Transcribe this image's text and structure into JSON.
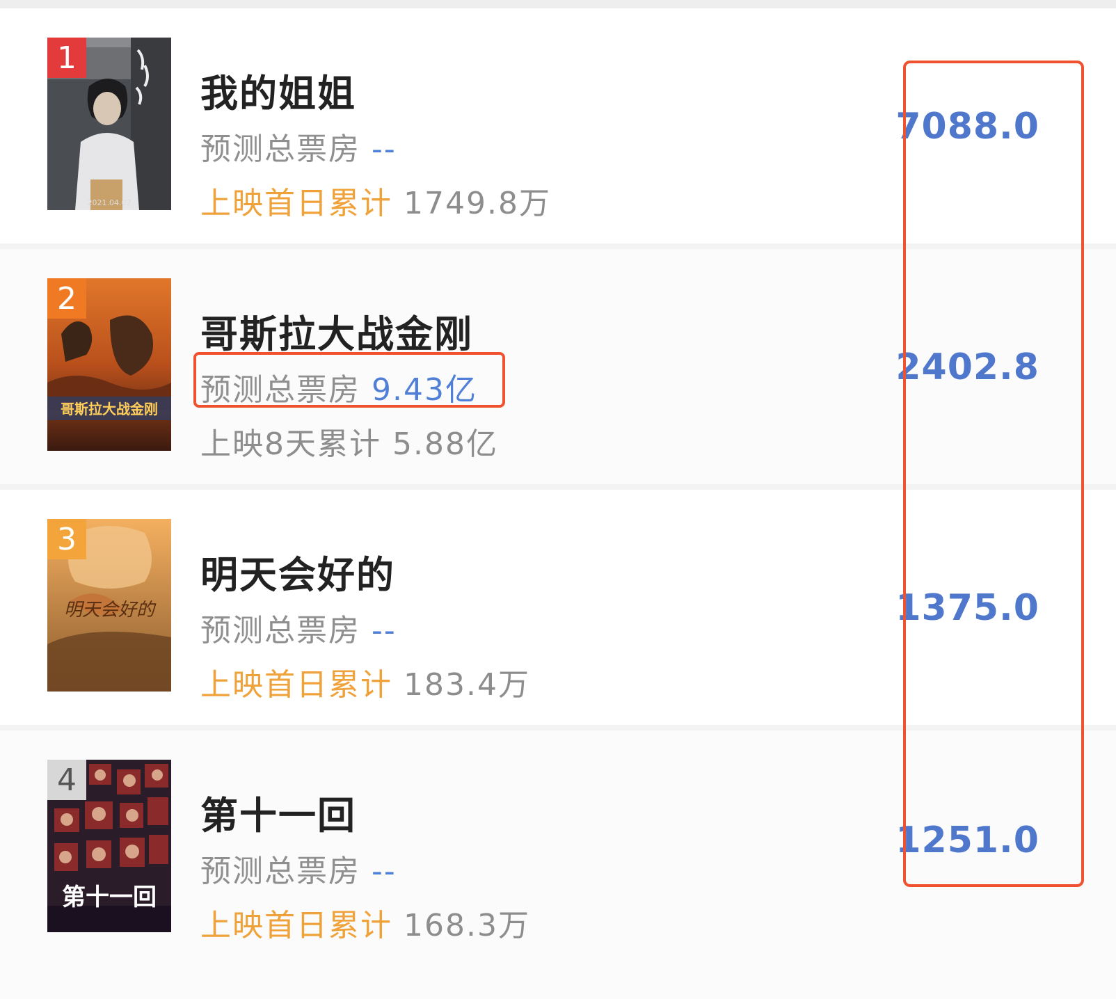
{
  "rankings": [
    {
      "rank": "1",
      "badge_color": "#e33b3b",
      "title": "我的姐姐",
      "forecast_label": "预测总票房",
      "forecast_value": "--",
      "cumulative_label": "上映首日累计",
      "cumulative_value": "1749.8万",
      "value": "7088.0",
      "poster_icon": "movie-poster-icon",
      "poster_caption": "2021.04.02"
    },
    {
      "rank": "2",
      "badge_color": "#f07a24",
      "title": "哥斯拉大战金刚",
      "forecast_label": "预测总票房",
      "forecast_value": "9.43亿",
      "cumulative_label": "上映8天累计",
      "cumulative_value": "5.88亿",
      "value": "2402.8",
      "poster_icon": "movie-poster-icon",
      "poster_caption": "哥斯拉大战金刚"
    },
    {
      "rank": "3",
      "badge_color": "#f3a53b",
      "title": "明天会好的",
      "forecast_label": "预测总票房",
      "forecast_value": "--",
      "cumulative_label": "上映首日累计",
      "cumulative_value": "183.4万",
      "value": "1375.0",
      "poster_icon": "movie-poster-icon",
      "poster_caption": "明天会好的"
    },
    {
      "rank": "4",
      "badge_color": "#d7d7d7",
      "title": "第十一回",
      "forecast_label": "预测总票房",
      "forecast_value": "--",
      "cumulative_label": "上映首日累计",
      "cumulative_value": "168.3万",
      "value": "1251.0",
      "poster_icon": "movie-poster-icon",
      "poster_caption": "第十一回"
    }
  ],
  "highlight_color": "#f0512e",
  "accent_blue": "#4f7fd6",
  "accent_orange": "#f0a23a"
}
